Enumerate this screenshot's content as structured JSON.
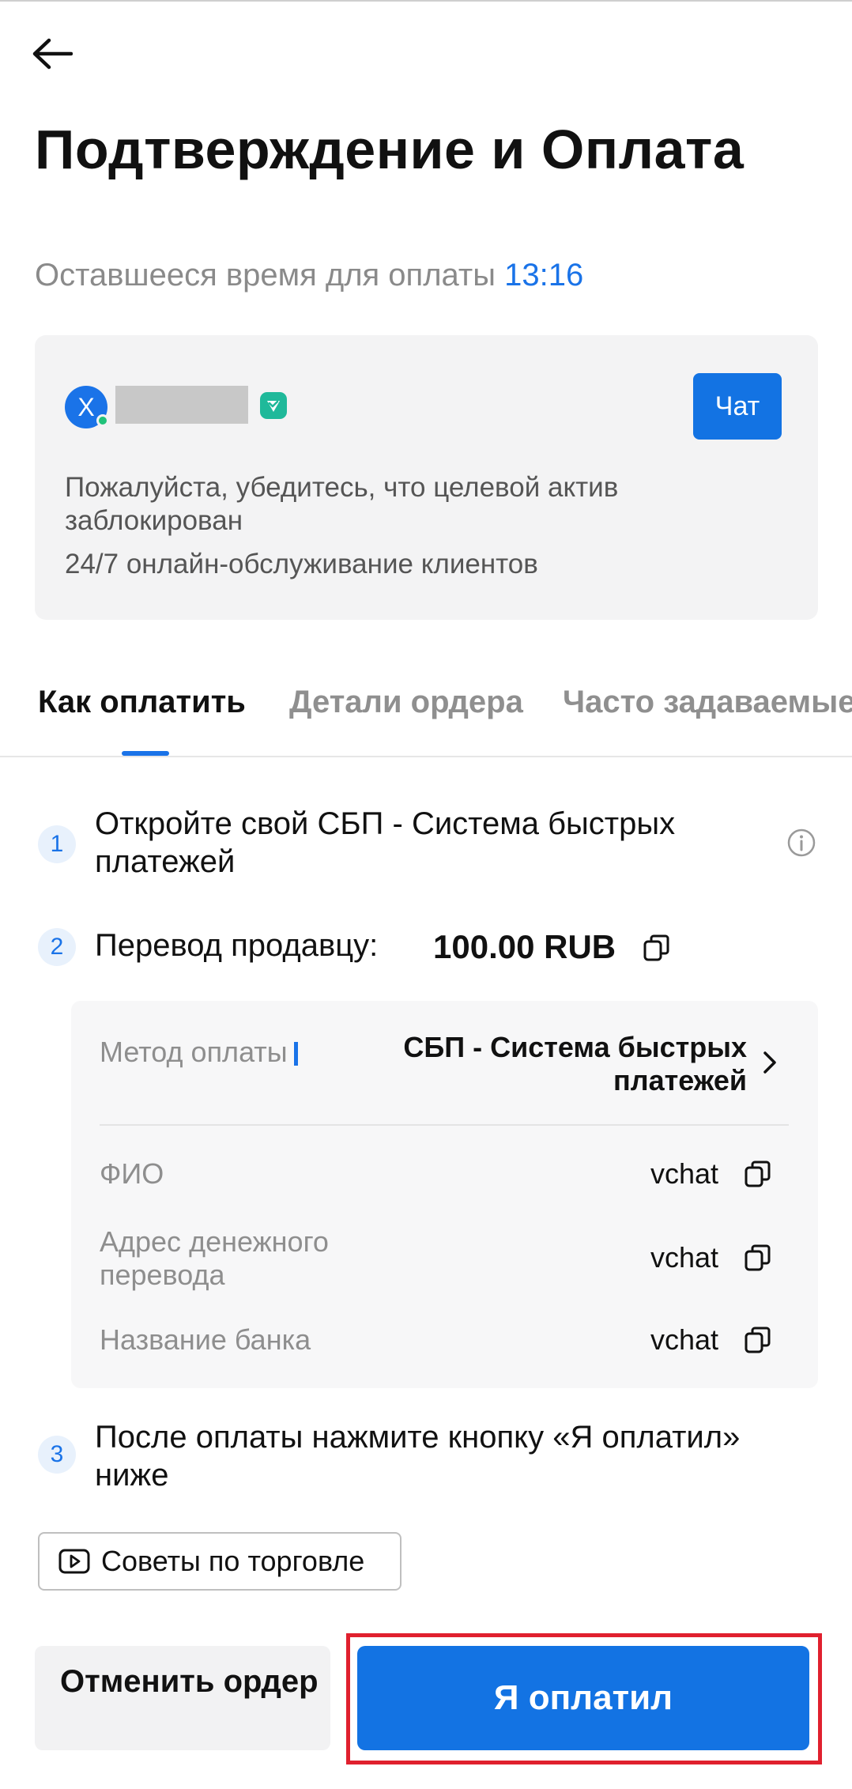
{
  "header": {
    "title": "Подтверждение и Оплата",
    "subtitle_prefix": "Оставшееся время для оплаты",
    "timer": "13:16"
  },
  "seller": {
    "avatar_letter": "X",
    "chat_label": "Чат",
    "note": "Пожалуйста, убедитесь, что целевой актив заблокирован",
    "support": "24/7 онлайн-обслуживание клиентов"
  },
  "tabs": [
    {
      "label": "Как оплатить",
      "active": true
    },
    {
      "label": "Детали ордера",
      "active": false
    },
    {
      "label": "Часто задаваемые",
      "active": false
    }
  ],
  "steps": {
    "step1": {
      "num": "1",
      "text": "Откройте свой СБП - Система быстрых платежей"
    },
    "step2": {
      "num": "2",
      "text": "Перевод продавцу:",
      "amount": "100.00 RUB"
    },
    "step3": {
      "num": "3",
      "text": "После оплаты нажмите кнопку «Я оплатил» ниже"
    }
  },
  "details": {
    "method_label": "Метод оплаты",
    "method_value": "СБП - Система быстрых платежей",
    "rows": [
      {
        "label": "ФИО",
        "value": "vchat"
      },
      {
        "label": "Адрес денежного перевода",
        "value": "vchat"
      },
      {
        "label": "Название банка",
        "value": "vchat"
      }
    ]
  },
  "tips_label": "Советы по торговле",
  "actions": {
    "cancel_label": "Отменить ордер",
    "paid_label": "Я оплатил"
  },
  "colors": {
    "accent": "#1a73e8",
    "button": "#1373e3",
    "highlight": "#e0202e",
    "online": "#20c27a",
    "verified": "#1fb99a"
  }
}
